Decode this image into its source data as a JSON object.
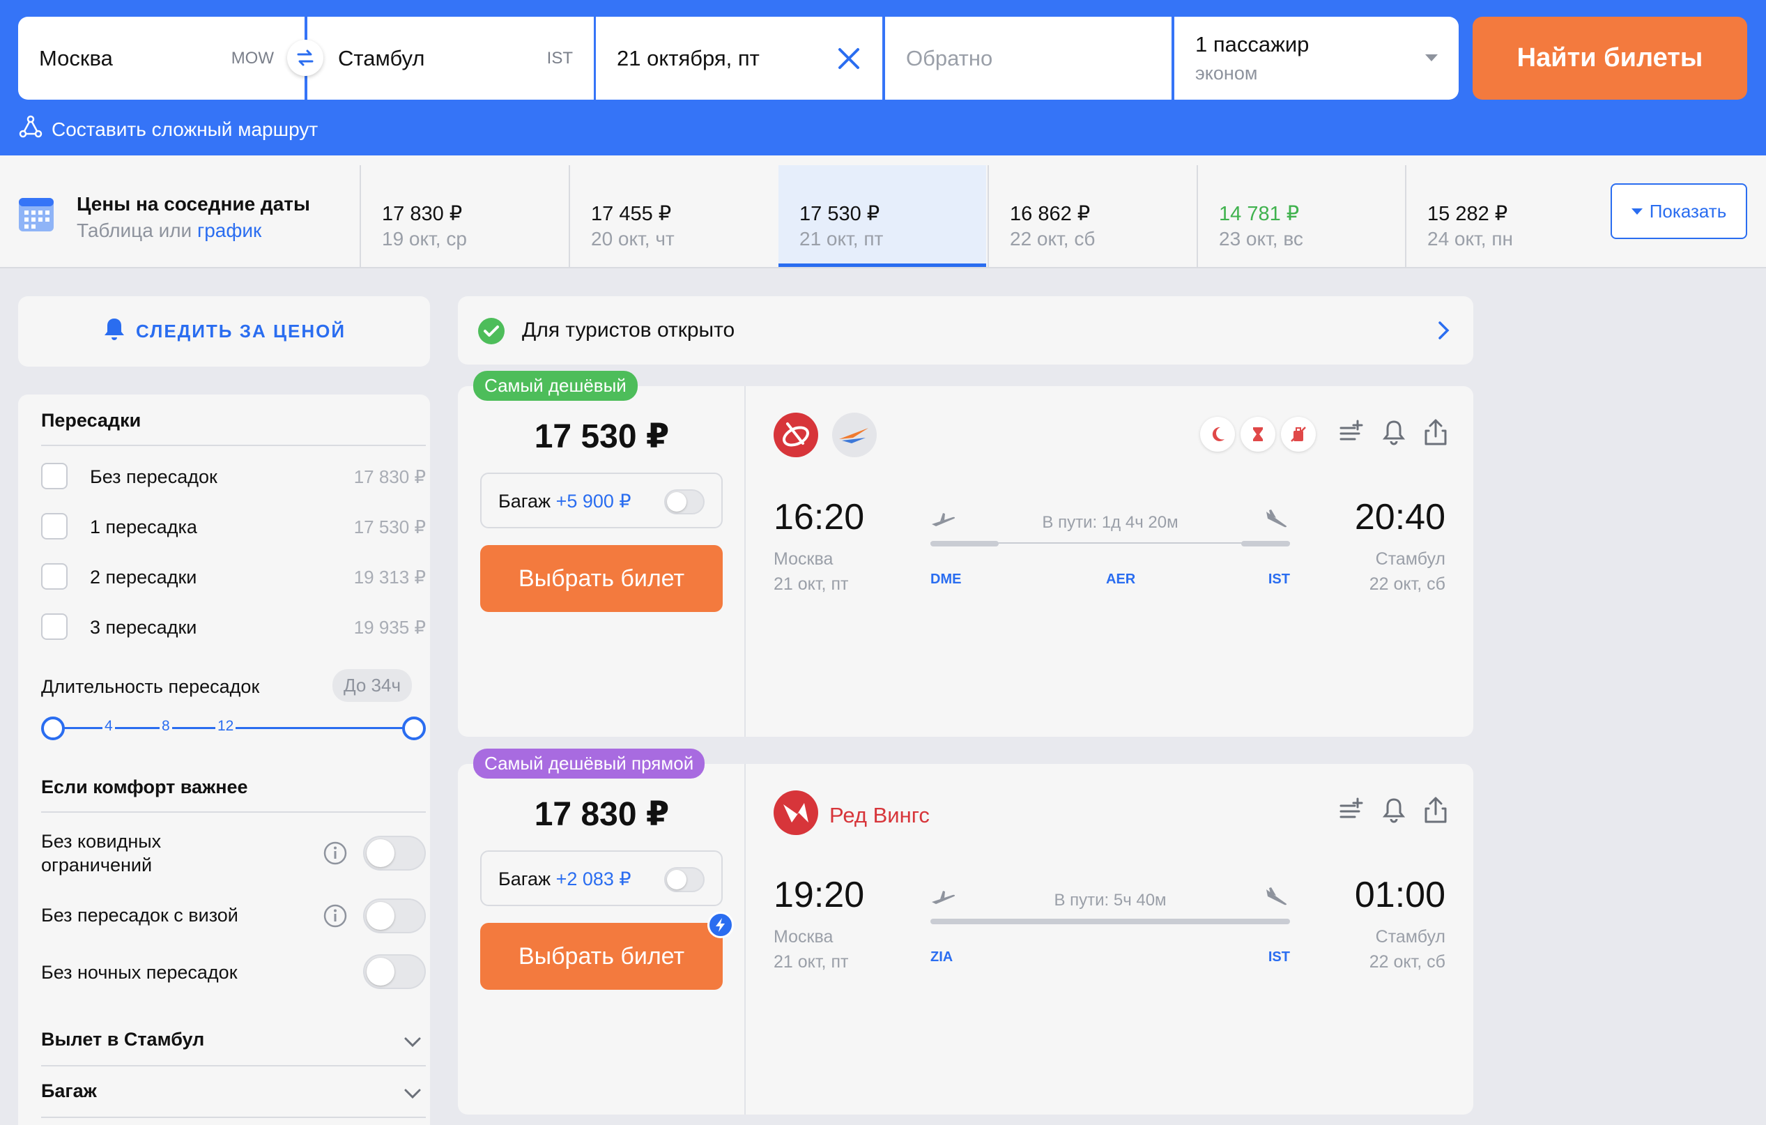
{
  "search": {
    "from_city": "Москва",
    "from_code": "MOW",
    "to_city": "Стамбул",
    "to_code": "IST",
    "date": "21 октября, пт",
    "return_placeholder": "Обратно",
    "passengers": "1 пассажир",
    "cabin": "эконом",
    "button": "Найти билеты",
    "complex_route": "Составить сложный маршрут"
  },
  "nearby": {
    "title": "Цены на соседние даты",
    "sub_table": "Таблица",
    "sub_or": " или ",
    "sub_graph": "график",
    "show_button": "Показать",
    "dates": [
      {
        "price": "17 830 ₽",
        "date": "19 окт, ср"
      },
      {
        "price": "17 455 ₽",
        "date": "20 окт, чт"
      },
      {
        "price": "17 530 ₽",
        "date": "21 окт, пт"
      },
      {
        "price": "16 862 ₽",
        "date": "22 окт, сб"
      },
      {
        "price": "14 781 ₽",
        "date": "23 окт, вс"
      },
      {
        "price": "15 282 ₽",
        "date": "24 окт, пн"
      }
    ],
    "active_index": 2,
    "cheapest_index": 4
  },
  "sidebar": {
    "watch_price": "СЛЕДИТЬ ЗА ЦЕНОЙ",
    "stops_title": "Пересадки",
    "stops": [
      {
        "label": "Без пересадок",
        "price": "17 830 ₽"
      },
      {
        "label": "1 пересадка",
        "price": "17 530 ₽"
      },
      {
        "label": "2 пересадки",
        "price": "19 313 ₽"
      },
      {
        "label": "3 пересадки",
        "price": "19 935 ₽"
      }
    ],
    "layover_label": "Длительность пересадок",
    "layover_badge": "До 34ч",
    "slider_ticks": [
      "4",
      "8",
      "12"
    ],
    "comfort_title": "Если комфорт важнее",
    "comfort": [
      {
        "label": "Без ковидных ограничений",
        "info": true
      },
      {
        "label": "Без пересадок с визой",
        "info": true
      },
      {
        "label": "Без ночных пересадок",
        "info": false
      }
    ],
    "accordions": [
      "Вылет в Стамбул",
      "Багаж"
    ]
  },
  "banner": {
    "text": "Для туристов открыто"
  },
  "tickets": [
    {
      "tag": "Самый дешёвый",
      "price": "17 530 ₽",
      "baggage_label": "Багаж ",
      "baggage_price": "+5 900 ₽",
      "buy": "Выбрать билет",
      "dep_time": "16:20",
      "dep_city": "Москва",
      "dep_date": "21 окт, пт",
      "duration": "В пути: 1д 4ч 20м",
      "arr_time": "20:40",
      "arr_city": "Стамбул",
      "arr_date": "22 окт, сб",
      "airports": [
        "DME",
        "AER",
        "IST"
      ]
    },
    {
      "tag": "Самый дешёвый прямой",
      "price": "17 830 ₽",
      "baggage_label": "Багаж ",
      "baggage_price": "+2 083 ₽",
      "buy": "Выбрать билет",
      "airline": "Ред Вингс",
      "dep_time": "19:20",
      "dep_city": "Москва",
      "dep_date": "21 окт, пт",
      "duration": "В пути: 5ч 40м",
      "arr_time": "01:00",
      "arr_city": "Стамбул",
      "arr_date": "22 окт, сб",
      "airports": [
        "ZIA",
        "IST"
      ]
    }
  ],
  "colors": {
    "header_blue": "#3574f7",
    "accent_orange": "#f37a3e",
    "link_blue": "#2a6df0",
    "cheap_green": "#40b24e",
    "tag_green": "#4dbd5a",
    "tag_purple": "#a86be0"
  },
  "icons": [
    "swap-icon",
    "close-icon",
    "route-icon",
    "calendar-icon",
    "bell-icon",
    "check-circle-icon",
    "chevron-right-icon",
    "info-icon",
    "chevron-down-icon",
    "night-icon",
    "hourglass-icon",
    "no-baggage-icon",
    "add-list-icon",
    "share-icon",
    "takeoff-icon",
    "landing-icon",
    "lightning-icon"
  ]
}
